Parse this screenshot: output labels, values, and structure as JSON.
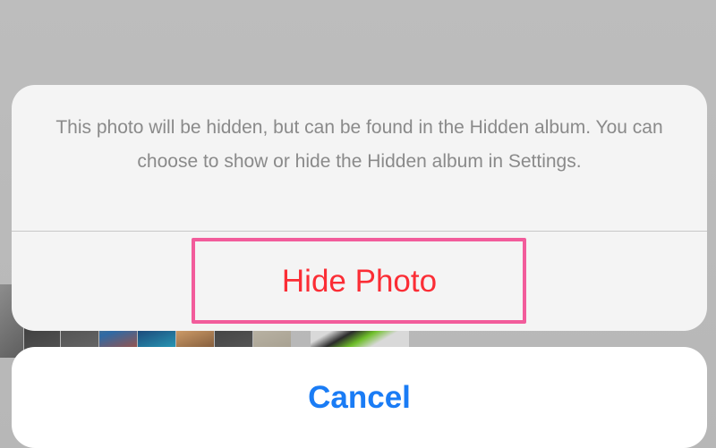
{
  "action_sheet": {
    "message": "This photo will be hidden, but can be found in the Hidden album. You can choose to show or hide the Hidden album in Settings.",
    "hide_label": "Hide Photo",
    "cancel_label": "Cancel"
  },
  "colors": {
    "destructive": "#fb2d35",
    "accent": "#1a7cf5",
    "highlight": "#f25c9b",
    "message_text": "#8a8a8a"
  }
}
